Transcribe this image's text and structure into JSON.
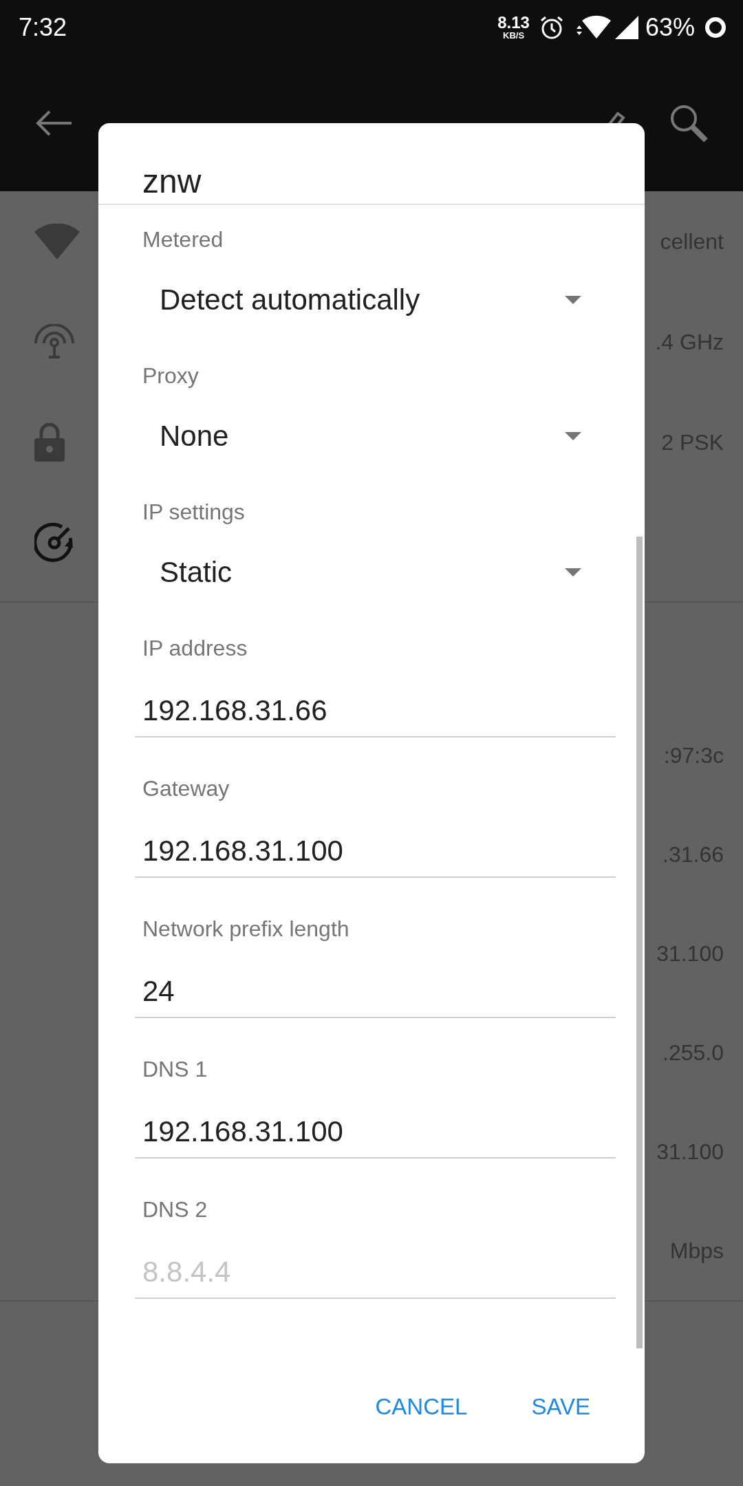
{
  "status_bar": {
    "time": "7:32",
    "speed": "8.13",
    "speed_unit": "KB/S",
    "battery": "63%"
  },
  "info_rows": [
    "cellent",
    ".4 GHz",
    "2 PSK"
  ],
  "detail_rows": [
    ":97:3c",
    ".31.66",
    "31.100",
    ".255.0",
    "31.100",
    "Mbps"
  ],
  "dialog": {
    "title": "znw",
    "fields": [
      {
        "kind": "dropdown",
        "label": "Metered",
        "value": "Detect automatically"
      },
      {
        "kind": "dropdown",
        "label": "Proxy",
        "value": "None"
      },
      {
        "kind": "dropdown",
        "label": "IP settings",
        "value": "Static"
      },
      {
        "kind": "input",
        "label": "IP address",
        "value": "192.168.31.66"
      },
      {
        "kind": "input",
        "label": "Gateway",
        "value": "192.168.31.100"
      },
      {
        "kind": "input",
        "label": "Network prefix length",
        "value": "24"
      },
      {
        "kind": "input",
        "label": "DNS 1",
        "value": "192.168.31.100"
      },
      {
        "kind": "input",
        "label": "DNS 2",
        "placeholder": "8.8.4.4"
      }
    ],
    "buttons": [
      "CANCEL",
      "SAVE"
    ]
  }
}
